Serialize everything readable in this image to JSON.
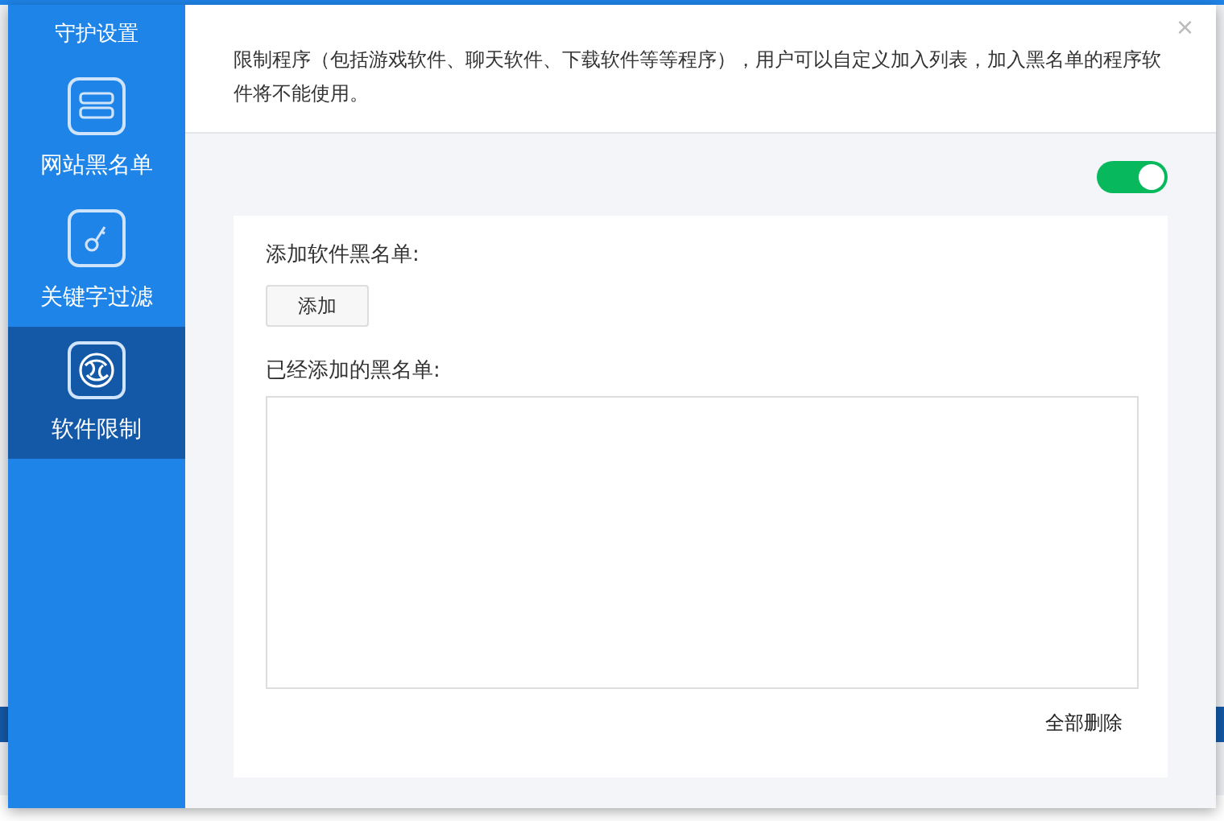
{
  "dialog": {
    "title": "守护设置",
    "close": "×",
    "sidebar": {
      "items": [
        {
          "label": "网站黑名单",
          "selected": false
        },
        {
          "label": "关键字过滤",
          "selected": false
        },
        {
          "label": "软件限制",
          "selected": true
        }
      ]
    },
    "description": "限制程序（包括游戏软件、聊天软件、下载软件等等程序），用户可以自定义加入列表，加入黑名单的程序软件将不能使用。",
    "enabled": true,
    "add_label": "添加软件黑名单:",
    "add_button": "添加",
    "list_label": "已经添加的黑名单:",
    "delete_all_button": "全部删除"
  }
}
